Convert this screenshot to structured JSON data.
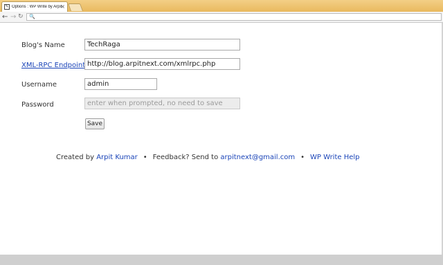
{
  "browser": {
    "tab_title": "Options : WP Write by Arpit",
    "tab_close": "×",
    "back": "←",
    "forward": "→",
    "reload": "↻",
    "address_icon": "🔍",
    "address_value": ""
  },
  "form": {
    "blog_name_label": "Blog's Name",
    "blog_name_value": "TechRaga",
    "endpoint_label": "XML-RPC Endpoint",
    "endpoint_value": "http://blog.arpitnext.com/xmlrpc.php",
    "username_label": "Username",
    "username_value": "admin",
    "password_label": "Password",
    "password_placeholder": "enter when prompted, no need to save",
    "save_label": "Save"
  },
  "footer": {
    "created_by": "Created by ",
    "author": "Arpit Kumar",
    "bullet": "•",
    "feedback": "Feedback? Send to ",
    "email": "arpitnext@gmail.com",
    "help": "WP Write Help"
  }
}
